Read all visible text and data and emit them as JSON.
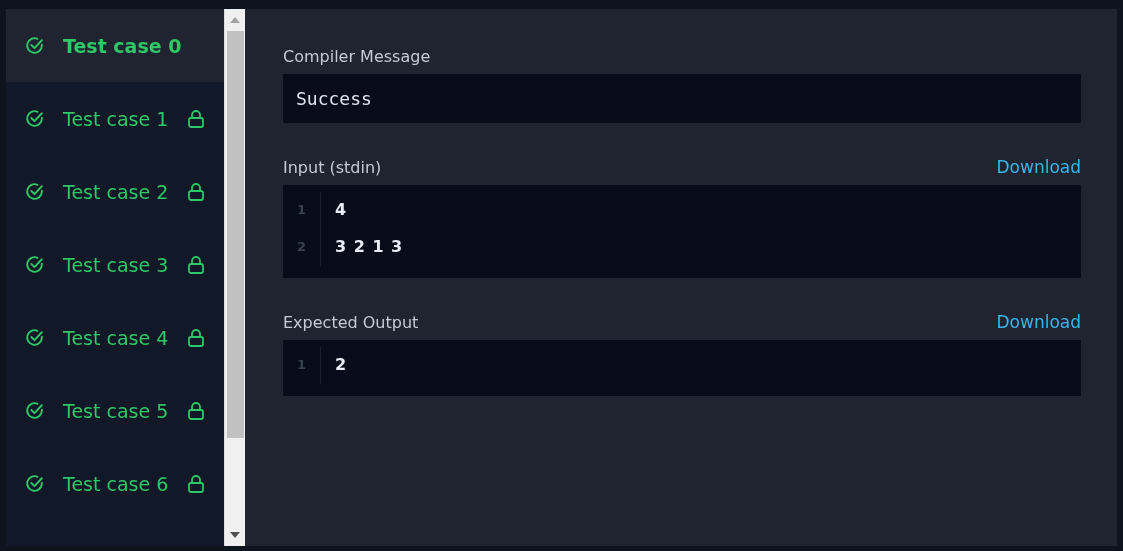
{
  "test_cases": [
    {
      "label": "Test case 0",
      "passed": true,
      "locked": false,
      "selected": true
    },
    {
      "label": "Test case 1",
      "passed": true,
      "locked": true,
      "selected": false
    },
    {
      "label": "Test case 2",
      "passed": true,
      "locked": true,
      "selected": false
    },
    {
      "label": "Test case 3",
      "passed": true,
      "locked": true,
      "selected": false
    },
    {
      "label": "Test case 4",
      "passed": true,
      "locked": true,
      "selected": false
    },
    {
      "label": "Test case 5",
      "passed": true,
      "locked": true,
      "selected": false
    },
    {
      "label": "Test case 6",
      "passed": true,
      "locked": true,
      "selected": false
    }
  ],
  "compiler": {
    "title": "Compiler Message",
    "message": "Success"
  },
  "input": {
    "title": "Input (stdin)",
    "download": "Download",
    "lines": [
      {
        "number": "1",
        "text": "4"
      },
      {
        "number": "2",
        "text": "3 2 1 3"
      }
    ]
  },
  "expected": {
    "title": "Expected Output",
    "download": "Download",
    "lines": [
      {
        "number": "1",
        "text": "2"
      }
    ]
  }
}
